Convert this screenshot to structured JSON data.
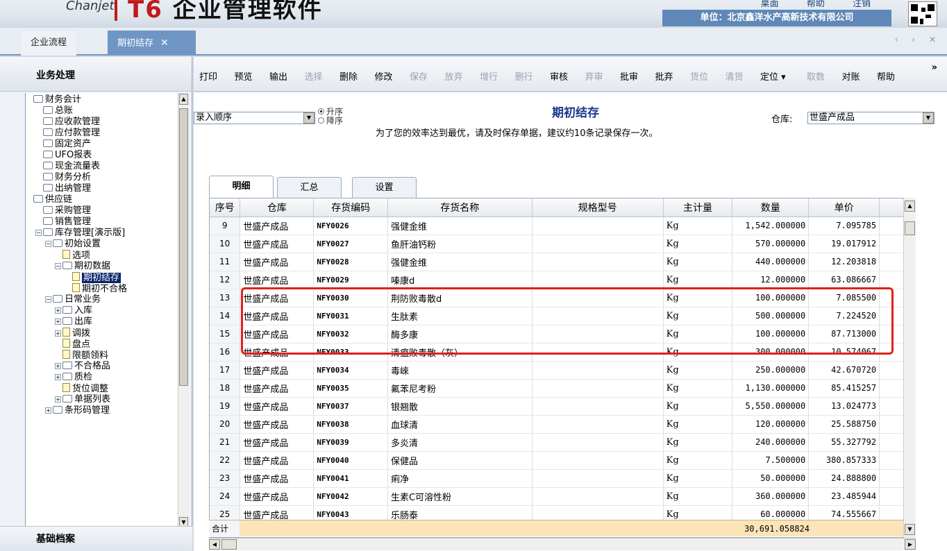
{
  "header": {
    "brand": "Chanjet",
    "product_prefix": "T6",
    "product_name": "企业管理软件",
    "links": [
      "桌面",
      "帮助",
      "注销"
    ],
    "company": "单位：北京鑫洋水产高新技术有限公司"
  },
  "tabs": {
    "flow": "企业流程",
    "active": "期初结存",
    "close": "✕",
    "nav": "‹ › ✕"
  },
  "sidebar": {
    "title": "业务处理",
    "footer": "基础档案",
    "tree": [
      {
        "label": "财务会计",
        "level": 0,
        "type": "folder",
        "pm": ""
      },
      {
        "label": "总账",
        "level": 1,
        "type": "folder",
        "pm": ""
      },
      {
        "label": "应收款管理",
        "level": 1,
        "type": "folder",
        "pm": ""
      },
      {
        "label": "应付款管理",
        "level": 1,
        "type": "folder",
        "pm": ""
      },
      {
        "label": "固定资产",
        "level": 1,
        "type": "folder",
        "pm": ""
      },
      {
        "label": "UFO报表",
        "level": 1,
        "type": "folder",
        "pm": ""
      },
      {
        "label": "现金流量表",
        "level": 1,
        "type": "folder",
        "pm": ""
      },
      {
        "label": "财务分析",
        "level": 1,
        "type": "folder",
        "pm": ""
      },
      {
        "label": "出纳管理",
        "level": 1,
        "type": "folder",
        "pm": ""
      },
      {
        "label": "供应链",
        "level": 0,
        "type": "folder",
        "pm": ""
      },
      {
        "label": "采购管理",
        "level": 1,
        "type": "folder",
        "pm": ""
      },
      {
        "label": "销售管理",
        "level": 1,
        "type": "folder",
        "pm": ""
      },
      {
        "label": "库存管理[演示版]",
        "level": 1,
        "type": "folder",
        "pm": "-"
      },
      {
        "label": "初始设置",
        "level": 2,
        "type": "folder",
        "pm": "-"
      },
      {
        "label": "选项",
        "level": 3,
        "type": "file",
        "pm": ""
      },
      {
        "label": "期初数据",
        "level": 3,
        "type": "folder",
        "pm": "-"
      },
      {
        "label": "期初结存",
        "level": 4,
        "type": "file",
        "pm": "",
        "selected": true
      },
      {
        "label": "期初不合格",
        "level": 4,
        "type": "file",
        "pm": ""
      },
      {
        "label": "日常业务",
        "level": 2,
        "type": "folder",
        "pm": "-"
      },
      {
        "label": "入库",
        "level": 3,
        "type": "folder",
        "pm": "+"
      },
      {
        "label": "出库",
        "level": 3,
        "type": "folder",
        "pm": "+"
      },
      {
        "label": "调拨",
        "level": 3,
        "type": "file",
        "pm": "+"
      },
      {
        "label": "盘点",
        "level": 3,
        "type": "file",
        "pm": ""
      },
      {
        "label": "限额领料",
        "level": 3,
        "type": "file",
        "pm": ""
      },
      {
        "label": "不合格品",
        "level": 3,
        "type": "folder",
        "pm": "+"
      },
      {
        "label": "质检",
        "level": 3,
        "type": "folder",
        "pm": "+"
      },
      {
        "label": "货位调整",
        "level": 3,
        "type": "file",
        "pm": ""
      },
      {
        "label": "单据列表",
        "level": 3,
        "type": "folder",
        "pm": "+"
      },
      {
        "label": "条形码管理",
        "level": 2,
        "type": "folder",
        "pm": "+"
      }
    ]
  },
  "toolbar": {
    "buttons": [
      {
        "label": "打印",
        "enabled": true
      },
      {
        "label": "预览",
        "enabled": true
      },
      {
        "label": "输出",
        "enabled": true
      },
      {
        "label": "选择",
        "enabled": false
      },
      {
        "label": "删除",
        "enabled": true
      },
      {
        "label": "修改",
        "enabled": true
      },
      {
        "label": "保存",
        "enabled": false
      },
      {
        "label": "放弃",
        "enabled": false
      },
      {
        "label": "增行",
        "enabled": false
      },
      {
        "label": "删行",
        "enabled": false
      },
      {
        "label": "审核",
        "enabled": true
      },
      {
        "label": "弃审",
        "enabled": false
      },
      {
        "label": "批审",
        "enabled": true
      },
      {
        "label": "批弃",
        "enabled": true
      },
      {
        "label": "货位",
        "enabled": false
      },
      {
        "label": "清货",
        "enabled": false
      },
      {
        "label": "定位 ▾",
        "enabled": true
      },
      {
        "label": "取数",
        "enabled": false
      },
      {
        "label": "对账",
        "enabled": true
      },
      {
        "label": "帮助",
        "enabled": true
      }
    ],
    "more": "»"
  },
  "form": {
    "sort_value": "录入顺序",
    "asc_label": "升序",
    "desc_label": "降序",
    "title": "期初结存",
    "note": "为了您的效率达到最优，请及时保存单据，建议约10条记录保存一次。",
    "warehouse_label": "仓库:",
    "warehouse_value": "世盛产成品"
  },
  "subtabs": [
    "明细",
    "汇总",
    "设置"
  ],
  "grid": {
    "columns": [
      "序号",
      "仓库",
      "存货编码",
      "存货名称",
      "规格型号",
      "主计量",
      "数量",
      "单价"
    ],
    "rows": [
      [
        "9",
        "世盛产成品",
        "NFY0026",
        "强健金维",
        "",
        "Kg",
        "1,542.000000",
        "7.095785"
      ],
      [
        "10",
        "世盛产成品",
        "NFY0027",
        "鱼肝油钙粉",
        "",
        "Kg",
        "570.000000",
        "19.017912"
      ],
      [
        "11",
        "世盛产成品",
        "NFY0028",
        "强健金维",
        "",
        "Kg",
        "440.000000",
        "12.203818"
      ],
      [
        "12",
        "世盛产成品",
        "NFY0029",
        "嗪康d",
        "",
        "Kg",
        "12.000000",
        "63.086667"
      ],
      [
        "13",
        "世盛产成品",
        "NFY0030",
        "荆防败毒散d",
        "",
        "Kg",
        "100.000000",
        "7.085500"
      ],
      [
        "14",
        "世盛产成品",
        "NFY0031",
        "生肽素",
        "",
        "Kg",
        "500.000000",
        "7.224520"
      ],
      [
        "15",
        "世盛产成品",
        "NFY0032",
        "酶多康",
        "",
        "Kg",
        "100.000000",
        "87.713000"
      ],
      [
        "16",
        "世盛产成品",
        "NFY0033",
        "清瘟败毒散（灰）",
        "",
        "Kg",
        "300.000000",
        "10.574067"
      ],
      [
        "17",
        "世盛产成品",
        "NFY0034",
        "毒崍",
        "",
        "Kg",
        "250.000000",
        "42.670720"
      ],
      [
        "18",
        "世盛产成品",
        "NFY0035",
        "氟苯尼考粉",
        "",
        "Kg",
        "1,130.000000",
        "85.415257"
      ],
      [
        "19",
        "世盛产成品",
        "NFY0037",
        "银翘散",
        "",
        "Kg",
        "5,550.000000",
        "13.024773"
      ],
      [
        "20",
        "世盛产成品",
        "NFY0038",
        "血球清",
        "",
        "Kg",
        "120.000000",
        "25.588750"
      ],
      [
        "21",
        "世盛产成品",
        "NFY0039",
        "多炎清",
        "",
        "Kg",
        "240.000000",
        "55.327792"
      ],
      [
        "22",
        "世盛产成品",
        "NFY0040",
        "保健品",
        "",
        "Kg",
        "7.500000",
        "380.857333"
      ],
      [
        "23",
        "世盛产成品",
        "NFY0041",
        "痢净",
        "",
        "Kg",
        "50.000000",
        "24.888800"
      ],
      [
        "24",
        "世盛产成品",
        "NFY0042",
        "生素C可溶性粉",
        "",
        "Kg",
        "360.000000",
        "23.485944"
      ],
      [
        "25",
        "世盛产成品",
        "NFY0043",
        "乐肠泰",
        "",
        "Kg",
        "60.000000",
        "74.555667"
      ]
    ],
    "total_label": "合计",
    "total_qty": "30,691.058824"
  }
}
